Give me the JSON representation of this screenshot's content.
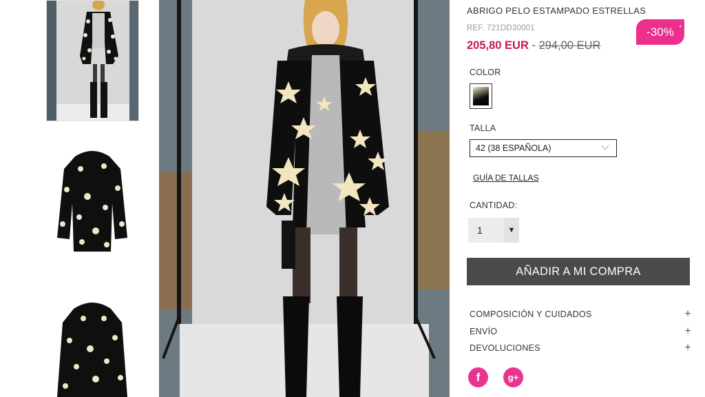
{
  "product": {
    "title": "ABRIGO PELO ESTAMPADO ESTRELLAS",
    "ref": "REF. 721DD30001",
    "price_now": "205,80 EUR",
    "price_separator": "-",
    "price_old": "294,00 EUR",
    "discount": "-30%",
    "discount_mark": "*"
  },
  "color_section": {
    "label": "COLOR",
    "swatch_icon": "black-cream-swatch"
  },
  "size_section": {
    "label": "TALLA",
    "selected": "42 (38 ESPAÑOLA)",
    "guide_link": "GUÍA DE TALLAS"
  },
  "quantity_section": {
    "label": "CANTIDAD:",
    "value": "1",
    "arrow": "▼"
  },
  "add_button": "AÑADIR A MI COMPRA",
  "accordion": [
    {
      "label": "COMPOSICIÓN Y CUIDADOS",
      "icon": "+"
    },
    {
      "label": "ENVÍO",
      "icon": "+"
    },
    {
      "label": "DEVOLUCIONES",
      "icon": "+"
    }
  ],
  "social": {
    "facebook": "f",
    "googleplus": "g+"
  },
  "colors": {
    "accent_pink": "#ec2f8c",
    "price_pink": "#c2185b",
    "button_gray": "#4a4a4a"
  }
}
